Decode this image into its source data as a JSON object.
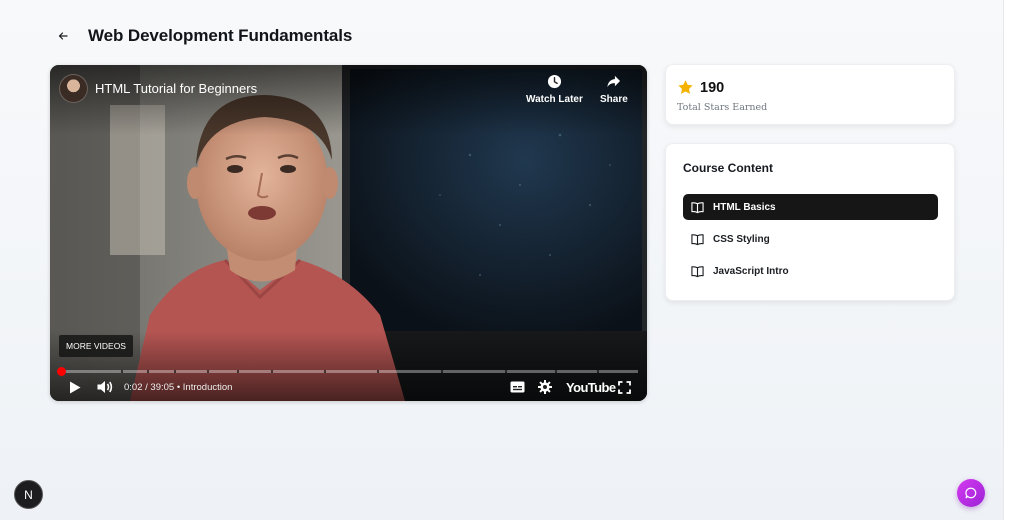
{
  "header": {
    "back_icon": "arrow-left-icon",
    "title": "Web Development Fundamentals"
  },
  "player": {
    "video_title": "HTML Tutorial for Beginners",
    "watch_later_label": "Watch Later",
    "share_label": "Share",
    "more_videos_label": "MORE VIDEOS",
    "time_text": "0:02 / 39:05 • Introduction",
    "brand_label": "YouTube",
    "progress_fraction": 0.00085,
    "accent_color": "#ff0000",
    "icons": [
      "clock-icon",
      "share-arrow-icon",
      "play-icon",
      "volume-icon",
      "captions-icon",
      "gear-icon",
      "fullscreen-icon"
    ]
  },
  "stars": {
    "value": "190",
    "label": "Total Stars Earned",
    "color": "#f5b301"
  },
  "course_content": {
    "title": "Course Content",
    "lessons": [
      {
        "label": "HTML Basics",
        "active": true
      },
      {
        "label": "CSS Styling",
        "active": false
      },
      {
        "label": "JavaScript Intro",
        "active": false
      }
    ]
  },
  "corner": {
    "badge_letter": "N",
    "chat_color": "#c22fe6"
  }
}
